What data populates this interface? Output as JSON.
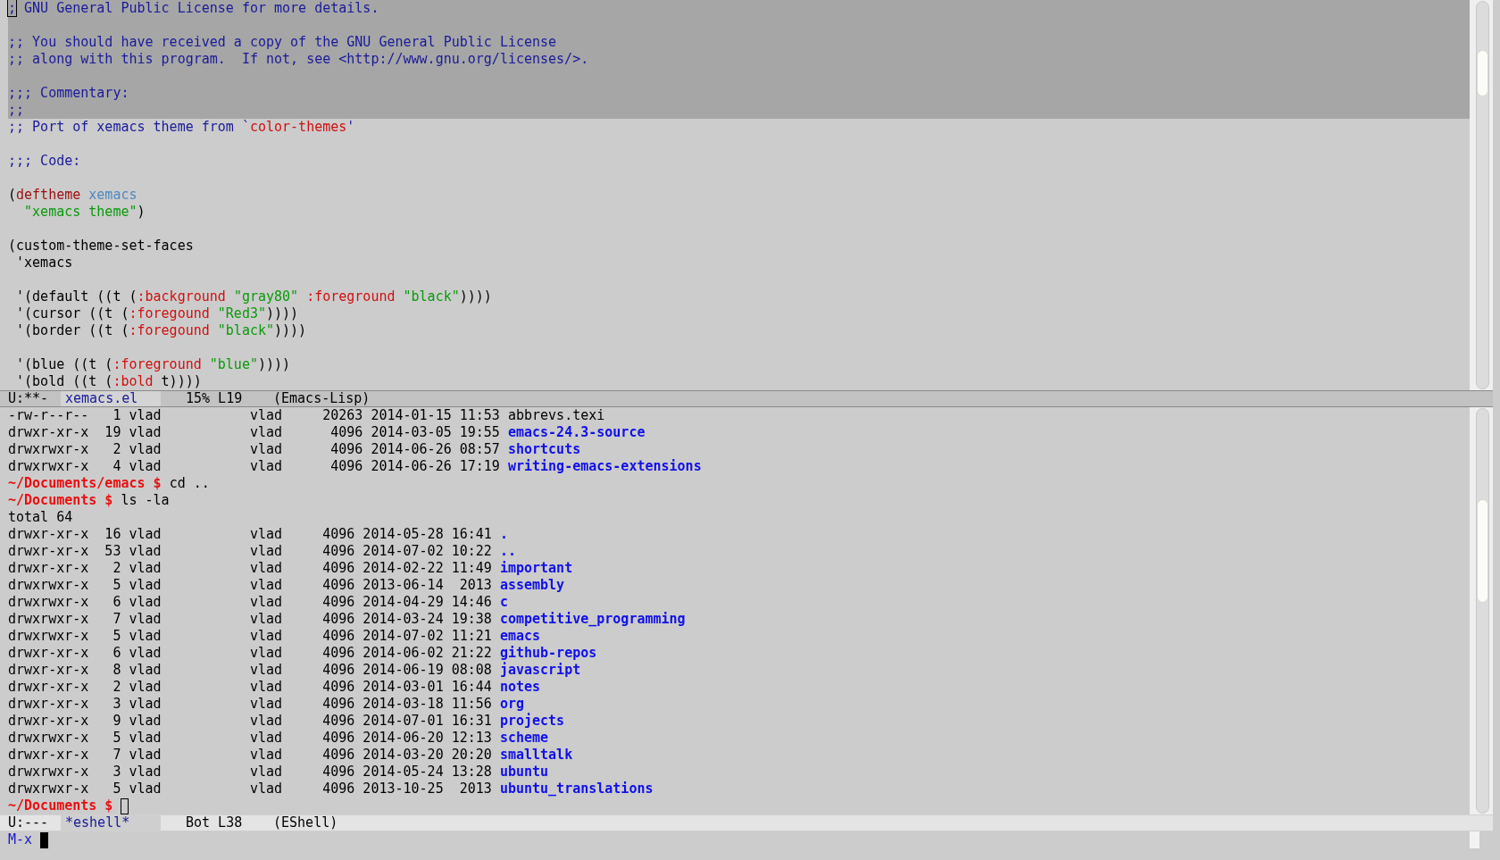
{
  "top_pane": {
    "lines": [
      {
        "selected": true,
        "segments": [
          {
            "text": ";",
            "kind": "comment",
            "cursor": true
          },
          {
            "text": " GNU General Public License for more details.",
            "kind": "comment"
          }
        ]
      },
      {
        "selected": true
      },
      {
        "selected": true,
        "segments": [
          {
            "text": ";; You should have received a copy of the GNU General Public License",
            "kind": "comment"
          }
        ]
      },
      {
        "selected": true,
        "segments": [
          {
            "text": ";; along with this program.  If not, see <http://www.gnu.org/licenses/>.",
            "kind": "comment"
          }
        ]
      },
      {
        "selected": true
      },
      {
        "selected": true,
        "segments": [
          {
            "text": ";;; Commentary:",
            "kind": "comment"
          }
        ]
      },
      {
        "selected": true,
        "segments": [
          {
            "text": ";;",
            "kind": "comment"
          }
        ]
      },
      {
        "selected": false,
        "segments": [
          {
            "text": ";; Port of xemacs theme from `",
            "kind": "comment"
          },
          {
            "text": "color-themes",
            "kind": "constant"
          },
          {
            "text": "'",
            "kind": "comment"
          }
        ]
      },
      {
        "selected": false
      },
      {
        "selected": false,
        "segments": [
          {
            "text": ";;; Code:",
            "kind": "comment"
          }
        ]
      },
      {
        "selected": false
      },
      {
        "selected": false,
        "segments": [
          {
            "text": "(",
            "kind": "plain"
          },
          {
            "text": "deftheme ",
            "kind": "keyword"
          },
          {
            "text": "xemacs",
            "kind": "name"
          }
        ]
      },
      {
        "selected": false,
        "segments": [
          {
            "text": "  \"xemacs theme\"",
            "kind": "string"
          },
          {
            "text": ")",
            "kind": "plain"
          }
        ]
      },
      {
        "selected": false
      },
      {
        "selected": false,
        "segments": [
          {
            "text": "(custom-theme-set-faces",
            "kind": "plain"
          }
        ]
      },
      {
        "selected": false,
        "segments": [
          {
            "text": " 'xemacs",
            "kind": "plain"
          }
        ]
      },
      {
        "selected": false
      },
      {
        "selected": false,
        "segments": [
          {
            "text": " '(default ((t (",
            "kind": "plain"
          },
          {
            "text": ":background ",
            "kind": "constant"
          },
          {
            "text": "\"gray80\" ",
            "kind": "string"
          },
          {
            "text": ":foreground ",
            "kind": "constant"
          },
          {
            "text": "\"black\"",
            "kind": "string"
          },
          {
            "text": "))))",
            "kind": "plain"
          }
        ]
      },
      {
        "selected": false,
        "segments": [
          {
            "text": " '(cursor ((t (",
            "kind": "plain"
          },
          {
            "text": ":foregound ",
            "kind": "constant"
          },
          {
            "text": "\"Red3\"",
            "kind": "string"
          },
          {
            "text": "))))",
            "kind": "plain"
          }
        ]
      },
      {
        "selected": false,
        "segments": [
          {
            "text": " '(border ((t (",
            "kind": "plain"
          },
          {
            "text": ":foregound ",
            "kind": "constant"
          },
          {
            "text": "\"black\"",
            "kind": "string"
          },
          {
            "text": "))))",
            "kind": "plain"
          }
        ]
      },
      {
        "selected": false
      },
      {
        "selected": false,
        "segments": [
          {
            "text": " '(blue ((t (",
            "kind": "plain"
          },
          {
            "text": ":foreground ",
            "kind": "constant"
          },
          {
            "text": "\"blue\"",
            "kind": "string"
          },
          {
            "text": "))))",
            "kind": "plain"
          }
        ]
      },
      {
        "selected": false,
        "segments": [
          {
            "text": " '(bold ((t (",
            "kind": "plain"
          },
          {
            "text": ":bold",
            "kind": "constant"
          },
          {
            "text": " t))))",
            "kind": "plain"
          }
        ]
      }
    ]
  },
  "top_mode_line": {
    "active": true,
    "status": "U:**-",
    "buffer": "xemacs.el",
    "position": "15% L19",
    "mode": "(Emacs-Lisp)"
  },
  "eshell_pane": {
    "lines": [
      {
        "segments": [
          {
            "text": "-rw-r--r--   1 vlad           vlad     20263 2014-01-15 11:53 ",
            "kind": "plain"
          },
          {
            "text": "abbrevs.texi",
            "kind": "file"
          }
        ]
      },
      {
        "segments": [
          {
            "text": "drwxr-xr-x  19 vlad           vlad      4096 2014-03-05 19:55 ",
            "kind": "plain"
          },
          {
            "text": "emacs-24.3-source",
            "kind": "dir"
          }
        ]
      },
      {
        "segments": [
          {
            "text": "drwxrwxr-x   2 vlad           vlad      4096 2014-06-26 08:57 ",
            "kind": "plain"
          },
          {
            "text": "shortcuts",
            "kind": "dir"
          }
        ]
      },
      {
        "segments": [
          {
            "text": "drwxrwxr-x   4 vlad           vlad      4096 2014-06-26 17:19 ",
            "kind": "plain"
          },
          {
            "text": "writing-emacs-extensions",
            "kind": "dir"
          }
        ]
      },
      {
        "segments": [
          {
            "text": "~/Documents/emacs $ ",
            "kind": "prompt"
          },
          {
            "text": "cd ..",
            "kind": "plain"
          }
        ]
      },
      {
        "segments": [
          {
            "text": "~/Documents $ ",
            "kind": "prompt"
          },
          {
            "text": "ls -la",
            "kind": "plain"
          }
        ]
      },
      {
        "segments": [
          {
            "text": "total 64",
            "kind": "plain"
          }
        ]
      },
      {
        "segments": [
          {
            "text": "drwxr-xr-x  16 vlad           vlad     4096 2014-05-28 16:41 ",
            "kind": "plain"
          },
          {
            "text": ".",
            "kind": "dir"
          }
        ]
      },
      {
        "segments": [
          {
            "text": "drwxr-xr-x  53 vlad           vlad     4096 2014-07-02 10:22 ",
            "kind": "plain"
          },
          {
            "text": "..",
            "kind": "dir"
          }
        ]
      },
      {
        "segments": [
          {
            "text": "drwxr-xr-x   2 vlad           vlad     4096 2014-02-22 11:49 ",
            "kind": "plain"
          },
          {
            "text": "important",
            "kind": "dir"
          }
        ]
      },
      {
        "segments": [
          {
            "text": "drwxrwxr-x   5 vlad           vlad     4096 2013-06-14  2013 ",
            "kind": "plain"
          },
          {
            "text": "assembly",
            "kind": "dir"
          }
        ]
      },
      {
        "segments": [
          {
            "text": "drwxrwxr-x   6 vlad           vlad     4096 2014-04-29 14:46 ",
            "kind": "plain"
          },
          {
            "text": "c",
            "kind": "dir"
          }
        ]
      },
      {
        "segments": [
          {
            "text": "drwxrwxr-x   7 vlad           vlad     4096 2014-03-24 19:38 ",
            "kind": "plain"
          },
          {
            "text": "competitive_programming",
            "kind": "dir"
          }
        ]
      },
      {
        "segments": [
          {
            "text": "drwxrwxr-x   5 vlad           vlad     4096 2014-07-02 11:21 ",
            "kind": "plain"
          },
          {
            "text": "emacs",
            "kind": "dir"
          }
        ]
      },
      {
        "segments": [
          {
            "text": "drwxr-xr-x   6 vlad           vlad     4096 2014-06-02 21:22 ",
            "kind": "plain"
          },
          {
            "text": "github-repos",
            "kind": "dir"
          }
        ]
      },
      {
        "segments": [
          {
            "text": "drwxr-xr-x   8 vlad           vlad     4096 2014-06-19 08:08 ",
            "kind": "plain"
          },
          {
            "text": "javascript",
            "kind": "dir"
          }
        ]
      },
      {
        "segments": [
          {
            "text": "drwxr-xr-x   2 vlad           vlad     4096 2014-03-01 16:44 ",
            "kind": "plain"
          },
          {
            "text": "notes",
            "kind": "dir"
          }
        ]
      },
      {
        "segments": [
          {
            "text": "drwxr-xr-x   3 vlad           vlad     4096 2014-03-18 11:56 ",
            "kind": "plain"
          },
          {
            "text": "org",
            "kind": "dir"
          }
        ]
      },
      {
        "segments": [
          {
            "text": "drwxr-xr-x   9 vlad           vlad     4096 2014-07-01 16:31 ",
            "kind": "plain"
          },
          {
            "text": "projects",
            "kind": "dir"
          }
        ]
      },
      {
        "segments": [
          {
            "text": "drwxrwxr-x   5 vlad           vlad     4096 2014-06-20 12:13 ",
            "kind": "plain"
          },
          {
            "text": "scheme",
            "kind": "dir"
          }
        ]
      },
      {
        "segments": [
          {
            "text": "drwxr-xr-x   7 vlad           vlad     4096 2014-03-20 20:20 ",
            "kind": "plain"
          },
          {
            "text": "smalltalk",
            "kind": "dir"
          }
        ]
      },
      {
        "segments": [
          {
            "text": "drwxrwxr-x   3 vlad           vlad     4096 2014-05-24 13:28 ",
            "kind": "plain"
          },
          {
            "text": "ubuntu",
            "kind": "dir"
          }
        ]
      },
      {
        "segments": [
          {
            "text": "drwxrwxr-x   5 vlad           vlad     4096 2013-10-25  2013 ",
            "kind": "plain"
          },
          {
            "text": "ubuntu_translations",
            "kind": "dir"
          }
        ]
      },
      {
        "cursor": true,
        "segments": [
          {
            "text": "~/Documents $ ",
            "kind": "prompt"
          }
        ]
      }
    ]
  },
  "bottom_mode_line": {
    "active": false,
    "status": "U:---",
    "buffer": "*eshell*",
    "position": "Bot L38",
    "mode": "(EShell)"
  },
  "minibuffer": {
    "prompt": "M-x",
    "cursor": true
  }
}
